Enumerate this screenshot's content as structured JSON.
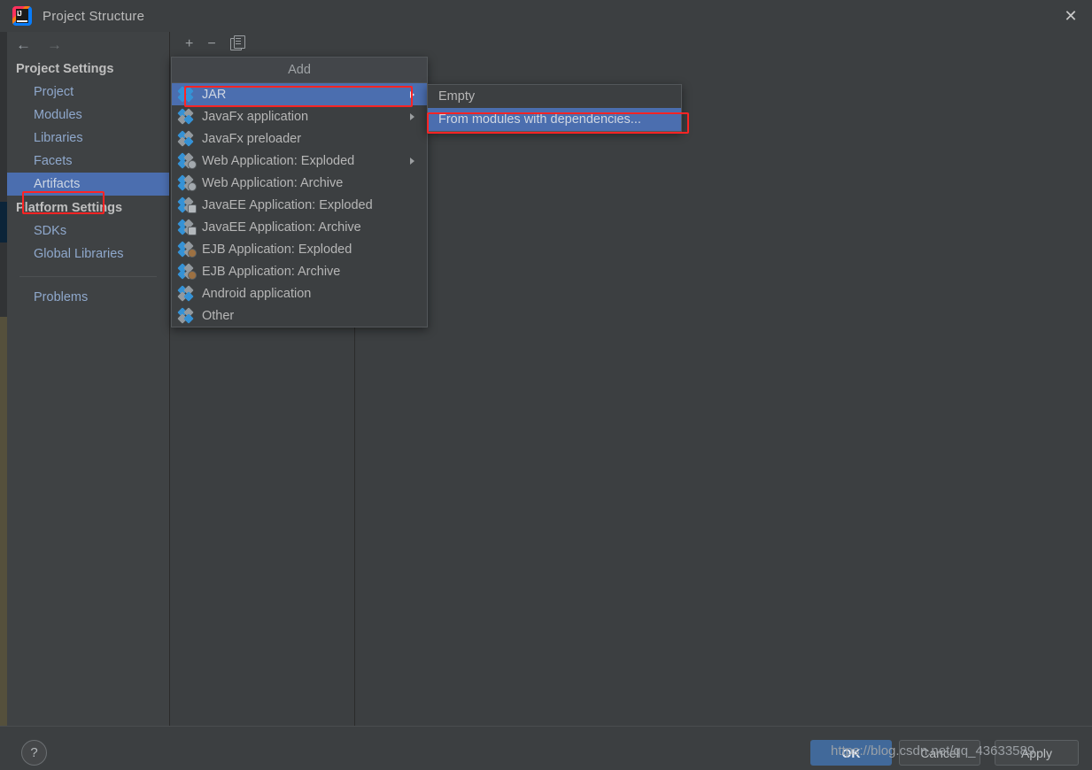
{
  "window": {
    "title": "Project Structure",
    "logo_icon": "intellij-idea-logo",
    "close_icon": "close-icon"
  },
  "sidebar": {
    "back_icon": "arrow-left-icon",
    "forward_icon": "arrow-right-icon",
    "groups": [
      {
        "label": "Project Settings",
        "items": [
          {
            "label": "Project",
            "selected": false
          },
          {
            "label": "Modules",
            "selected": false
          },
          {
            "label": "Libraries",
            "selected": false
          },
          {
            "label": "Facets",
            "selected": false
          },
          {
            "label": "Artifacts",
            "selected": true
          }
        ]
      },
      {
        "label": "Platform Settings",
        "items": [
          {
            "label": "SDKs",
            "selected": false
          },
          {
            "label": "Global Libraries",
            "selected": false
          }
        ]
      }
    ],
    "problems": {
      "label": "Problems"
    }
  },
  "toolbar": {
    "add_icon": "plus-icon",
    "remove_icon": "minus-icon",
    "copy_icon": "copy-icon"
  },
  "add_menu": {
    "title": "Add",
    "items": [
      {
        "label": "JAR",
        "icon": "jar-icon",
        "has_submenu": true,
        "selected": true
      },
      {
        "label": "JavaFx application",
        "icon": "javafx-app-icon",
        "has_submenu": true,
        "selected": false
      },
      {
        "label": "JavaFx preloader",
        "icon": "javafx-preloader-icon",
        "has_submenu": false,
        "selected": false
      },
      {
        "label": "Web Application: Exploded",
        "icon": "web-exploded-icon",
        "has_submenu": true,
        "selected": false
      },
      {
        "label": "Web Application: Archive",
        "icon": "web-archive-icon",
        "has_submenu": false,
        "selected": false
      },
      {
        "label": "JavaEE Application: Exploded",
        "icon": "javaee-exploded-icon",
        "has_submenu": false,
        "selected": false
      },
      {
        "label": "JavaEE Application: Archive",
        "icon": "javaee-archive-icon",
        "has_submenu": false,
        "selected": false
      },
      {
        "label": "EJB Application: Exploded",
        "icon": "ejb-exploded-icon",
        "has_submenu": false,
        "selected": false
      },
      {
        "label": "EJB Application: Archive",
        "icon": "ejb-archive-icon",
        "has_submenu": false,
        "selected": false
      },
      {
        "label": "Android application",
        "icon": "android-app-icon",
        "has_submenu": false,
        "selected": false
      },
      {
        "label": "Other",
        "icon": "other-icon",
        "has_submenu": false,
        "selected": false
      }
    ]
  },
  "jar_submenu": {
    "items": [
      {
        "label": "Empty",
        "selected": false
      },
      {
        "label": "From modules with dependencies...",
        "selected": true
      }
    ]
  },
  "footer": {
    "help_label": "?",
    "ok_label": "OK",
    "cancel_label": "Cancel",
    "apply_label": "Apply"
  },
  "watermark": {
    "text": "https://blog.csdn.net/qq_43633589"
  },
  "colors": {
    "selection_blue": "#4b6eaf",
    "annotation_red": "#ff2424",
    "ok_button_blue": "#41699a",
    "dialog_bg": "#3c3f41",
    "icon_blue": "#3592d6"
  }
}
